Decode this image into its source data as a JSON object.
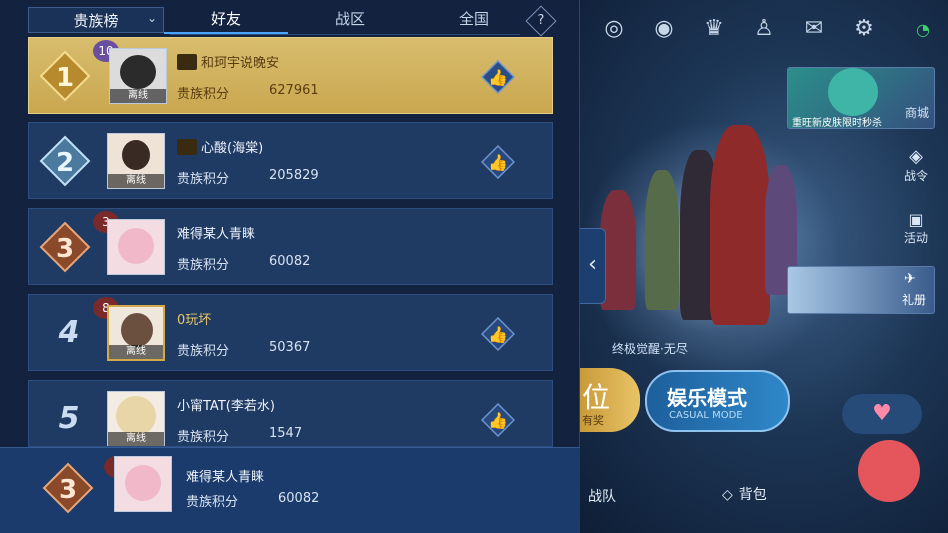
{
  "tabs": {
    "selector": "贵族榜",
    "items": [
      {
        "label": "好友",
        "active": true
      },
      {
        "label": "战区",
        "active": false
      },
      {
        "label": "全国",
        "active": false
      }
    ],
    "help": "?"
  },
  "rows": [
    {
      "rank": "1",
      "name": "和珂宇说晚安",
      "svip": true,
      "vip_level": "10",
      "offline": "离线",
      "label": "贵族积分",
      "score": "627961",
      "like": true
    },
    {
      "rank": "2",
      "name": "心酸(海棠)",
      "svip": true,
      "vip_level": "",
      "offline": "离线",
      "label": "贵族积分",
      "score": "205829",
      "like": true
    },
    {
      "rank": "3",
      "name": "难得某人青睐",
      "svip": false,
      "vip_level": "3",
      "offline": "",
      "label": "贵族积分",
      "score": "60082",
      "like": false
    },
    {
      "rank": "4",
      "name": "0玩坏",
      "svip": false,
      "vip_level": "8",
      "offline": "离线",
      "label": "贵族积分",
      "score": "50367",
      "like": true
    },
    {
      "rank": "5",
      "name": "小甯TAT(李若水)",
      "svip": false,
      "vip_level": "",
      "offline": "离线",
      "label": "贵族积分",
      "score": "1547",
      "like": true
    }
  ],
  "mine": {
    "rank": "3",
    "name": "难得某人青睐",
    "vip_level": "3",
    "label": "贵族积分",
    "score": "60082"
  },
  "right": {
    "banner_text": "重旺新皮肤限时秒杀",
    "shop": "商城",
    "pass": "战令",
    "activity": "活动",
    "gift": "礼册",
    "event_text": "终极觉醒·无尽",
    "mode_left": "位",
    "mode_left_sub": "有奖",
    "mode_title": "娱乐模式",
    "mode_sub": "CASUAL MODE",
    "team": "战队",
    "bag": "背包"
  },
  "colors": {
    "gold": "#c9a74f",
    "row_bg": "#1f3a63",
    "panel_bg": "#12223f",
    "accent": "#4aa2ff"
  }
}
